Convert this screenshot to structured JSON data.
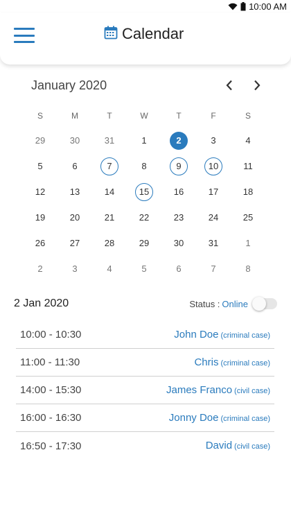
{
  "status_bar": {
    "time": "10:00 AM",
    "wifi_icon": "wifi-icon",
    "battery_icon": "battery-icon"
  },
  "header": {
    "title": "Calendar",
    "menu_icon": "hamburger-menu-icon",
    "title_icon": "calendar-icon"
  },
  "calendar": {
    "month_label": "January 2020",
    "weekdays": [
      "S",
      "M",
      "T",
      "W",
      "T",
      "F",
      "S"
    ],
    "days": [
      {
        "label": "29",
        "muted": true
      },
      {
        "label": "30",
        "muted": true
      },
      {
        "label": "31",
        "muted": true
      },
      {
        "label": "1"
      },
      {
        "label": "2",
        "selected": true
      },
      {
        "label": "3"
      },
      {
        "label": "4"
      },
      {
        "label": "5"
      },
      {
        "label": "6"
      },
      {
        "label": "7",
        "event": true
      },
      {
        "label": "8"
      },
      {
        "label": "9",
        "event": true
      },
      {
        "label": "10",
        "event": true
      },
      {
        "label": "11"
      },
      {
        "label": "12"
      },
      {
        "label": "13"
      },
      {
        "label": "14"
      },
      {
        "label": "15",
        "event": true
      },
      {
        "label": "16"
      },
      {
        "label": "17"
      },
      {
        "label": "18"
      },
      {
        "label": "19"
      },
      {
        "label": "20"
      },
      {
        "label": "21"
      },
      {
        "label": "22"
      },
      {
        "label": "23"
      },
      {
        "label": "24"
      },
      {
        "label": "25"
      },
      {
        "label": "26"
      },
      {
        "label": "27"
      },
      {
        "label": "28"
      },
      {
        "label": "29"
      },
      {
        "label": "30"
      },
      {
        "label": "31"
      },
      {
        "label": "1",
        "muted": true
      },
      {
        "label": "2",
        "muted": true
      },
      {
        "label": "3",
        "muted": true
      },
      {
        "label": "4",
        "muted": true
      },
      {
        "label": "5",
        "muted": true
      },
      {
        "label": "6",
        "muted": true
      },
      {
        "label": "7",
        "muted": true
      },
      {
        "label": "8",
        "muted": true
      }
    ]
  },
  "schedule": {
    "date_label": "2 Jan 2020",
    "status_label": "Status :",
    "status_value": "Online",
    "status_enabled": false,
    "appointments": [
      {
        "time": "10:00 - 10:30",
        "name": "John Doe",
        "type": "(criminal case)"
      },
      {
        "time": "11:00 - 11:30",
        "name": "Chris",
        "type": "(criminal case)"
      },
      {
        "time": "14:00 - 15:30",
        "name": "James Franco",
        "type": "(civil case)"
      },
      {
        "time": "16:00 - 16:30",
        "name": "Jonny Doe",
        "type": "(criminal case)"
      },
      {
        "time": "16:50 - 17:30",
        "name": "David",
        "type": "(civil case)"
      }
    ]
  },
  "colors": {
    "accent": "#2a7bbd",
    "text": "#333333",
    "muted": "#777777"
  }
}
